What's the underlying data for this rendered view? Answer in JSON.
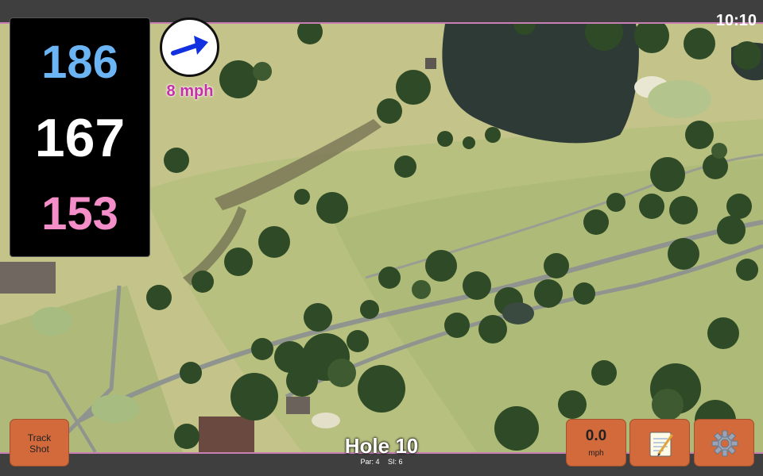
{
  "status": {
    "time": "10:10"
  },
  "yardages": {
    "back": "186",
    "center": "167",
    "front": "153"
  },
  "wind": {
    "speed": "8 mph",
    "arrow_icon": "right-arrow-icon"
  },
  "buttons": {
    "track_shot": "Track\nShot",
    "speed_value": "0.0",
    "speed_unit": "mph",
    "notes_icon": "notepad-icon",
    "settings_icon": "gear-icon"
  },
  "hole": {
    "title": "Hole 10",
    "par": "Par: 4",
    "si": "SI: 6"
  },
  "colors": {
    "accent_border": "#c77fb4",
    "button": "#d26a3b",
    "back_yardage": "#6bb5f5",
    "front_yardage": "#f48ec8",
    "wind_text": "#c530a8"
  }
}
